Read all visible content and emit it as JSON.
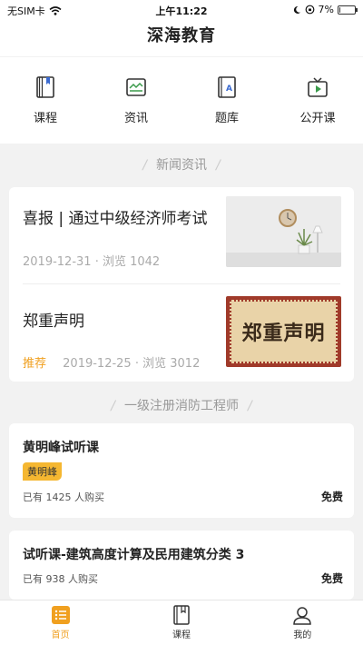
{
  "status_bar": {
    "carrier": "无SIM卡",
    "time": "上午11:22",
    "battery": "7%",
    "battery_level": 0.07
  },
  "header": {
    "title": "深海教育"
  },
  "quick_nav": [
    {
      "label": "课程",
      "icon": "book-icon"
    },
    {
      "label": "资讯",
      "icon": "news-icon"
    },
    {
      "label": "题库",
      "icon": "question-bank-icon"
    },
    {
      "label": "公开课",
      "icon": "tv-icon"
    }
  ],
  "sections": {
    "news": "新闻资讯",
    "courses": "一级注册消防工程师"
  },
  "news": [
    {
      "title": "喜报 | 通过中级经济师考试",
      "tag": "",
      "date": "2019-12-31",
      "views": "浏览 1042",
      "thumb": "clock-and-plant"
    },
    {
      "title": "郑重声明",
      "tag": "推荐",
      "date": "2019-12-25",
      "views": "浏览 3012",
      "thumb_text": "郑重声明"
    }
  ],
  "courses": [
    {
      "title": "黄明峰试听课",
      "teacher": "黄明峰",
      "buyers": "已有 1425 人购买",
      "price": "免费"
    },
    {
      "title": "试听课-建筑高度计算及民用建筑分类 3",
      "teacher": "",
      "buyers": "已有 938 人购买",
      "price": "免费"
    }
  ],
  "tabs": [
    {
      "label": "首页",
      "icon": "home-list-icon",
      "active": true
    },
    {
      "label": "课程",
      "icon": "book-icon",
      "active": false
    },
    {
      "label": "我的",
      "icon": "user-icon",
      "active": false
    }
  ],
  "colors": {
    "accent": "#f0a020",
    "teacher_badge": "#f5b731",
    "nav_icon_green": "#3a9a4a"
  }
}
